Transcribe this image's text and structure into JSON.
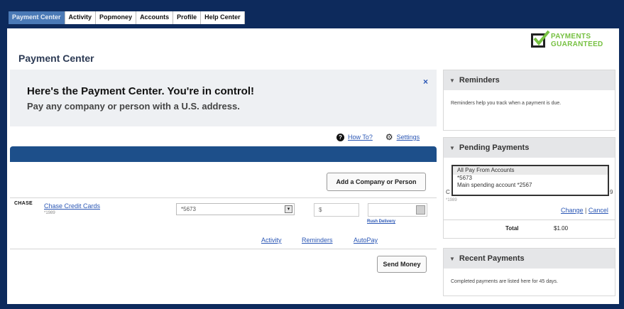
{
  "tabs": [
    {
      "label": "Payment Center",
      "active": true
    },
    {
      "label": "Activity",
      "active": false
    },
    {
      "label": "Popmoney",
      "active": false
    },
    {
      "label": "Accounts",
      "active": false
    },
    {
      "label": "Profile",
      "active": false
    },
    {
      "label": "Help Center",
      "active": false
    }
  ],
  "badge": {
    "line1": "PAYMENTS",
    "line2": "GUARANTEED"
  },
  "page_title": "Payment Center",
  "banner": {
    "headline": "Here's the Payment Center. You're in control!",
    "subline": "Pay any company or person with a U.S. address.",
    "close": "×"
  },
  "help": {
    "how_to": "How To?",
    "settings": "Settings",
    "help_glyph": "?",
    "gear_glyph": "⚙"
  },
  "add_button": "Add a Company or Person",
  "payee": {
    "logo": "CHASE",
    "name": "Chase Credit Cards",
    "account": "*1989",
    "from_account": "*5673",
    "amount": "$",
    "rush_delivery": "Rush Delivery",
    "arrow": "▾"
  },
  "row_links": {
    "activity": "Activity",
    "reminders": "Reminders",
    "autopay": "AutoPay"
  },
  "send_button": "Send Money",
  "reminders": {
    "title": "Reminders",
    "body": "Reminders help you track when a payment is due."
  },
  "pending": {
    "title": "Pending Payments",
    "popup_title": "All Pay From Accounts",
    "popup_line1": "*5673",
    "popup_line2": "Main spending account *2567",
    "left_fragment": "C",
    "right_fragment": "9",
    "account_fragment": "*1989",
    "change": "Change",
    "separator": "|",
    "cancel": "Cancel",
    "total_label": "Total",
    "total_value": "$1.00"
  },
  "recent": {
    "title": "Recent Payments",
    "body": "Completed payments are listed here for 45 days."
  },
  "caret": "▼",
  "colors": {
    "navy": "#0d2a5c",
    "bar": "#1d4f8a",
    "active_tab": "#4a79b6",
    "guarantee": "#77c142",
    "link": "#2b57b5"
  }
}
